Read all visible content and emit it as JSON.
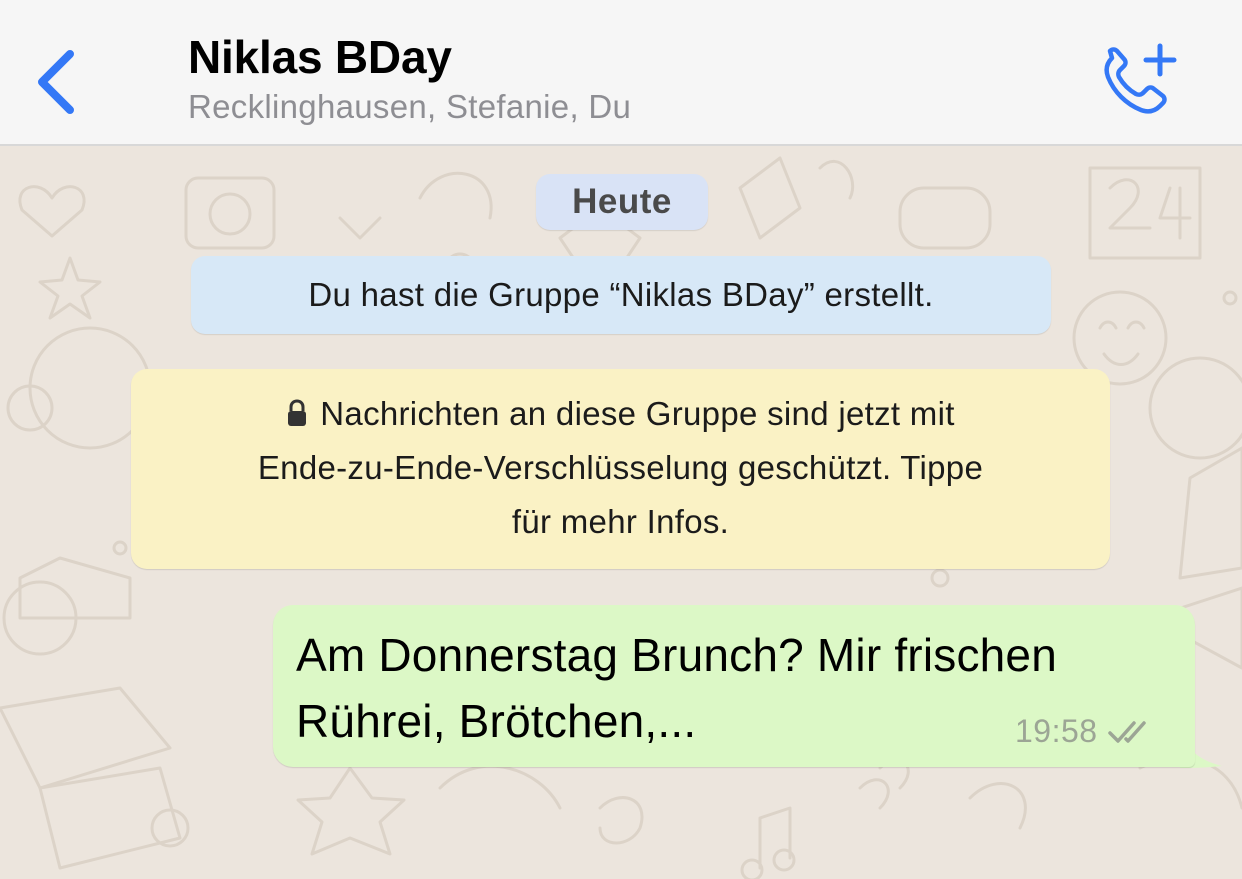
{
  "header": {
    "title": "Niklas BDay",
    "subtitle": "Recklinghausen, Stefanie, Du",
    "back_icon": "chevron-left-icon",
    "call_icon": "phone-add-icon",
    "accent_color": "#3478f6"
  },
  "chat": {
    "date_label": "Heute",
    "system_message": "Du hast die Gruppe “Niklas BDay” erstellt.",
    "encryption_notice": {
      "icon": "lock-icon",
      "line1": "Nachrichten an diese Gruppe sind jetzt mit",
      "line2": "Ende-zu-Ende-Verschlüsselung geschützt. Tippe",
      "line3": "für mehr Infos."
    },
    "messages": [
      {
        "direction": "outgoing",
        "line1": "Am Donnerstag Brunch? Mir frischen",
        "line2": "Rührei, Brötchen,...",
        "time": "19:58",
        "status": "delivered",
        "status_icon": "double-check-icon"
      }
    ]
  },
  "colors": {
    "header_bg": "#f6f6f6",
    "chat_bg": "#ece5dd",
    "date_pill_bg": "#d9e3f6",
    "system_bg": "#d7e8f7",
    "encryption_bg": "#faf2c5",
    "outgoing_bubble_bg": "#dcf8c6"
  }
}
